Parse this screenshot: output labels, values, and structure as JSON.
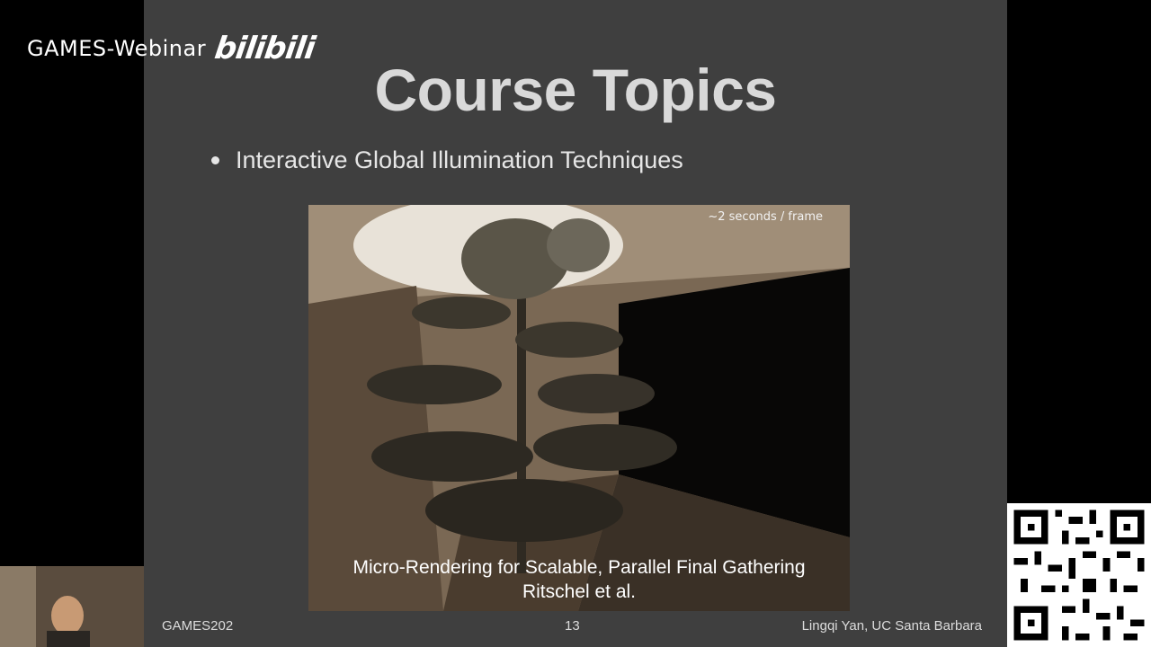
{
  "watermark": {
    "text": "GAMES-Webinar",
    "logo": "bilibili"
  },
  "slide": {
    "title": "Course Topics",
    "bullet": "Interactive Global Illumination Techniques",
    "image": {
      "timing": "~2 seconds / frame",
      "caption_line1": "Micro-Rendering for Scalable, Parallel Final Gathering",
      "caption_line2": "Ritschel et al."
    },
    "footer": {
      "course": "GAMES202",
      "page": "13",
      "author": "Lingqi Yan, UC Santa Barbara"
    }
  },
  "icons": [
    "qr-code-icon",
    "bullet-dot-icon"
  ]
}
